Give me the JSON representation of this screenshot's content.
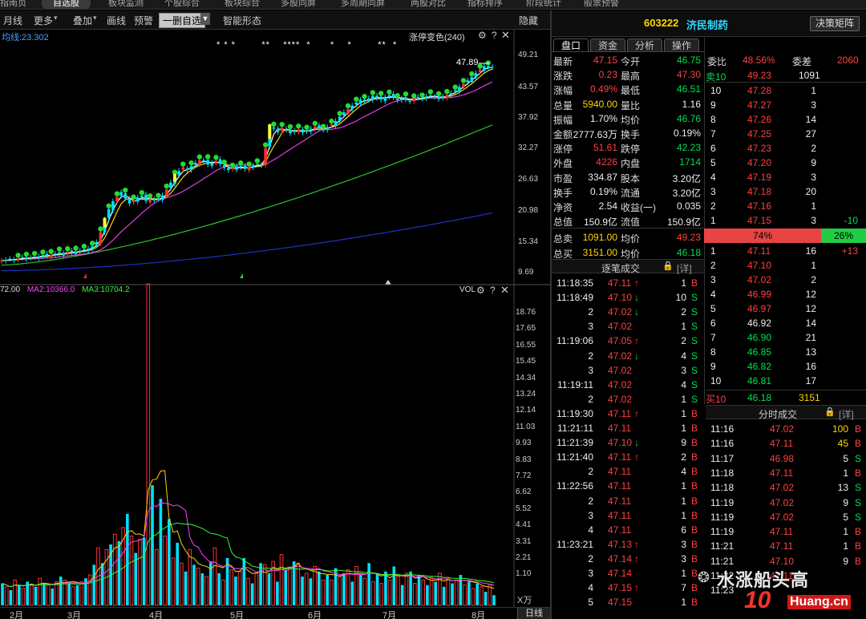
{
  "top_tabs": [
    {
      "label": "指南页",
      "active": false
    },
    {
      "label": "自选股",
      "active": true
    },
    {
      "label": "板块监测",
      "active": false
    },
    {
      "label": "个股综合",
      "active": false
    },
    {
      "label": "板块综合",
      "active": false
    },
    {
      "label": "多股同屏",
      "active": false
    },
    {
      "label": "多周期同屏",
      "active": false
    },
    {
      "label": "两股对比",
      "active": false
    },
    {
      "label": "指标排序",
      "active": false
    },
    {
      "label": "阶段统计",
      "active": false
    },
    {
      "label": "般票预警",
      "active": false
    }
  ],
  "toolbar": {
    "period": "月线",
    "more": "更多",
    "overlay": "叠加",
    "draw": "画线",
    "warn": "预警",
    "delete_watch": "一删自选",
    "smart_shape": "智能形态",
    "hide": "隐藏"
  },
  "kline": {
    "ma_label": "均线:23.302",
    "indicator": "涨停变色(240)",
    "price_tag": "47.89",
    "y_ticks": [
      "49.21",
      "43.57",
      "37.92",
      "32.27",
      "26.63",
      "20.98",
      "15.34",
      "9.69"
    ],
    "markers": "* * *        **    ****  *      *    *        **  *"
  },
  "volume": {
    "ma_labels": [
      "72.00",
      "MA2:10366.0",
      "MA3:10704.2"
    ],
    "title": "VOL",
    "y_ticks": [
      "18.76",
      "17.65",
      "16.55",
      "15.45",
      "14.34",
      "13.24",
      "12.14",
      "11.03",
      "9.93",
      "8.83",
      "7.72",
      "6.62",
      "5.52",
      "4.41",
      "3.31",
      "2.21",
      "1.10"
    ],
    "unit": "X万"
  },
  "x_axis": {
    "months": [
      "2月",
      "3月",
      "4月",
      "5月",
      "6月",
      "7月",
      "8月"
    ],
    "period_btn": "日线"
  },
  "stock": {
    "code": "603222",
    "name": "济民制药",
    "decision_btn": "决策矩阵"
  },
  "panel_tabs": [
    "盘口",
    "资金",
    "分析",
    "操作"
  ],
  "quote": [
    {
      "l1": "最新",
      "v1": "47.15",
      "c1": "red",
      "l2": "今开",
      "v2": "46.75",
      "c2": "green"
    },
    {
      "l1": "涨跌",
      "v1": "0.23",
      "c1": "red",
      "l2": "最高",
      "v2": "47.30",
      "c2": "red"
    },
    {
      "l1": "涨幅",
      "v1": "0.49%",
      "c1": "red",
      "l2": "最低",
      "v2": "46.51",
      "c2": "green"
    },
    {
      "l1": "总量",
      "v1": "5940.00",
      "c1": "yellow",
      "l2": "量比",
      "v2": "1.16",
      "c2": "white"
    },
    {
      "l1": "振幅",
      "v1": "1.70%",
      "c1": "white",
      "l2": "均价",
      "v2": "46.76",
      "c2": "green"
    },
    {
      "l1": "金额",
      "v1": "2777.63万",
      "c1": "white",
      "l2": "换手",
      "v2": "0.19%",
      "c2": "white"
    },
    {
      "l1": "涨停",
      "v1": "51.61",
      "c1": "red",
      "l2": "跌停",
      "v2": "42.23",
      "c2": "green"
    },
    {
      "l1": "外盘",
      "v1": "4226",
      "c1": "red",
      "l2": "内盘",
      "v2": "1714",
      "c2": "green"
    },
    {
      "l1": "市盈",
      "v1": "334.87",
      "c1": "white",
      "l2": "股本",
      "v2": "3.20亿",
      "c2": "white"
    },
    {
      "l1": "换手",
      "v1": "0.19%",
      "c1": "white",
      "l2": "流通",
      "v2": "3.20亿",
      "c2": "white"
    },
    {
      "l1": "净资",
      "v1": "2.54",
      "c1": "white",
      "l2": "收益(一)",
      "v2": "0.035",
      "c2": "white"
    },
    {
      "l1": "总值",
      "v1": "150.9亿",
      "c1": "white",
      "l2": "流值",
      "v2": "150.9亿",
      "c2": "white"
    },
    {
      "l1": "总卖",
      "v1": "1091.00",
      "c1": "yellow",
      "l2": "均价",
      "v2": "49.23",
      "c2": "red"
    },
    {
      "l1": "总买",
      "v1": "3151.00",
      "c1": "yellow",
      "l2": "均价",
      "v2": "46.18",
      "c2": "green"
    }
  ],
  "order_book": {
    "ratio_label": "委比",
    "ratio_value": "48.56%",
    "diff_label": "委差",
    "diff_value": "2060",
    "sell10": {
      "label": "卖10",
      "price": "49.23",
      "vol": "1091"
    },
    "sells": [
      {
        "lvl": "10",
        "price": "47.28",
        "vol": "1",
        "chg": ""
      },
      {
        "lvl": "9",
        "price": "47.27",
        "vol": "3",
        "chg": ""
      },
      {
        "lvl": "8",
        "price": "47.26",
        "vol": "14",
        "chg": ""
      },
      {
        "lvl": "7",
        "price": "47.25",
        "vol": "27",
        "chg": ""
      },
      {
        "lvl": "6",
        "price": "47.23",
        "vol": "2",
        "chg": ""
      },
      {
        "lvl": "5",
        "price": "47.20",
        "vol": "9",
        "chg": ""
      },
      {
        "lvl": "4",
        "price": "47.19",
        "vol": "3",
        "chg": ""
      },
      {
        "lvl": "3",
        "price": "47.18",
        "vol": "20",
        "chg": ""
      },
      {
        "lvl": "2",
        "price": "47.16",
        "vol": "1",
        "chg": ""
      },
      {
        "lvl": "1",
        "price": "47.15",
        "vol": "3",
        "chg": "-10"
      }
    ],
    "sell_pct": "74%",
    "buy_pct": "26%",
    "sell_frac": 0.74,
    "buys": [
      {
        "lvl": "1",
        "price": "47.11",
        "pc": "red",
        "vol": "16",
        "chg": "+13"
      },
      {
        "lvl": "2",
        "price": "47.10",
        "pc": "red",
        "vol": "1",
        "chg": ""
      },
      {
        "lvl": "3",
        "price": "47.02",
        "pc": "red",
        "vol": "2",
        "chg": ""
      },
      {
        "lvl": "4",
        "price": "46.99",
        "pc": "red",
        "vol": "12",
        "chg": ""
      },
      {
        "lvl": "5",
        "price": "46.97",
        "pc": "red",
        "vol": "12",
        "chg": ""
      },
      {
        "lvl": "6",
        "price": "46.92",
        "pc": "white",
        "vol": "14",
        "chg": ""
      },
      {
        "lvl": "7",
        "price": "46.90",
        "pc": "green",
        "vol": "21",
        "chg": ""
      },
      {
        "lvl": "8",
        "price": "46.85",
        "pc": "green",
        "vol": "13",
        "chg": ""
      },
      {
        "lvl": "9",
        "price": "46.82",
        "pc": "green",
        "vol": "16",
        "chg": ""
      },
      {
        "lvl": "10",
        "price": "46.81",
        "pc": "green",
        "vol": "17",
        "chg": ""
      }
    ],
    "buy10": {
      "label": "买10",
      "price": "46.18",
      "vol": "3151"
    }
  },
  "tick_trades": {
    "title": "逐笔成交",
    "detail": "[详]",
    "rows": [
      {
        "t": "11:18:35",
        "p": "47.11",
        "a": "up",
        "v": "1",
        "bs": "B"
      },
      {
        "t": "11:18:49",
        "p": "47.10",
        "a": "down",
        "v": "10",
        "bs": "S"
      },
      {
        "t": "2",
        "p": "47.02",
        "a": "down",
        "v": "2",
        "bs": "S"
      },
      {
        "t": "3",
        "p": "47.02",
        "a": "",
        "v": "1",
        "bs": "S"
      },
      {
        "t": "11:19:06",
        "p": "47.05",
        "a": "up",
        "v": "2",
        "bs": "S"
      },
      {
        "t": "2",
        "p": "47.02",
        "a": "down",
        "v": "4",
        "bs": "S"
      },
      {
        "t": "3",
        "p": "47.02",
        "a": "",
        "v": "3",
        "bs": "S"
      },
      {
        "t": "11:19:11",
        "p": "47.02",
        "a": "",
        "v": "4",
        "bs": "S"
      },
      {
        "t": "2",
        "p": "47.02",
        "a": "",
        "v": "1",
        "bs": "S"
      },
      {
        "t": "11:19:30",
        "p": "47.11",
        "a": "up",
        "v": "1",
        "bs": "B"
      },
      {
        "t": "11:21:11",
        "p": "47.11",
        "a": "",
        "v": "1",
        "bs": "B"
      },
      {
        "t": "11:21:39",
        "p": "47.10",
        "a": "down",
        "v": "9",
        "bs": "B"
      },
      {
        "t": "11:21:40",
        "p": "47.11",
        "a": "up",
        "v": "2",
        "bs": "B"
      },
      {
        "t": "2",
        "p": "47.11",
        "a": "",
        "v": "4",
        "bs": "B"
      },
      {
        "t": "11:22:56",
        "p": "47.11",
        "a": "",
        "v": "1",
        "bs": "B"
      },
      {
        "t": "2",
        "p": "47.11",
        "a": "",
        "v": "1",
        "bs": "B"
      },
      {
        "t": "3",
        "p": "47.11",
        "a": "",
        "v": "1",
        "bs": "B"
      },
      {
        "t": "4",
        "p": "47.11",
        "a": "",
        "v": "6",
        "bs": "B"
      },
      {
        "t": "11:23:21",
        "p": "47.13",
        "a": "up",
        "v": "3",
        "bs": "B"
      },
      {
        "t": "2",
        "p": "47.14",
        "a": "up",
        "v": "3",
        "bs": "B"
      },
      {
        "t": "3",
        "p": "47.14",
        "a": "",
        "v": "1",
        "bs": "B"
      },
      {
        "t": "4",
        "p": "47.15",
        "a": "up",
        "v": "7",
        "bs": "B"
      },
      {
        "t": "5",
        "p": "47.15",
        "a": "",
        "v": "1",
        "bs": "B"
      }
    ]
  },
  "minute_trades": {
    "title": "分时成交",
    "detail": "[详]",
    "rows": [
      {
        "t": "11:16",
        "p": "47.02",
        "pc": "red",
        "v": "100",
        "bs": "B"
      },
      {
        "t": "11:16",
        "p": "47.11",
        "pc": "red",
        "v": "45",
        "bs": "B"
      },
      {
        "t": "11:17",
        "p": "46.98",
        "pc": "red",
        "v": "5",
        "bs": "S"
      },
      {
        "t": "11:18",
        "p": "47.11",
        "pc": "red",
        "v": "1",
        "bs": "B"
      },
      {
        "t": "11:18",
        "p": "47.02",
        "pc": "red",
        "v": "13",
        "bs": "S"
      },
      {
        "t": "11:19",
        "p": "47.02",
        "pc": "red",
        "v": "9",
        "bs": "S"
      },
      {
        "t": "11:19",
        "p": "47.02",
        "pc": "red",
        "v": "5",
        "bs": "S"
      },
      {
        "t": "11:19",
        "p": "47.11",
        "pc": "red",
        "v": "1",
        "bs": "B"
      },
      {
        "t": "11:21",
        "p": "47.11",
        "pc": "red",
        "v": "1",
        "bs": "B"
      },
      {
        "t": "11:21",
        "p": "47.10",
        "pc": "red",
        "v": "9",
        "bs": "B"
      },
      {
        "t": "11:22",
        "p": "47.11",
        "pc": "red",
        "v": "",
        "bs": ""
      },
      {
        "t": "11:23",
        "p": "",
        "pc": "red",
        "v": "",
        "bs": ""
      }
    ]
  },
  "watermark": {
    "text": "水涨船头高",
    "brand": "Huang.cn",
    "badge": "10"
  },
  "chart_data": [
    {
      "type": "candlestick",
      "price_axis": [
        9.69,
        49.21
      ],
      "close": [
        12.0,
        12.1,
        12.3,
        12.2,
        12.4,
        12.5,
        12.6,
        12.5,
        12.7,
        12.8,
        13.0,
        12.9,
        13.1,
        13.3,
        13.2,
        13.4,
        13.6,
        13.5,
        13.7,
        13.8,
        14.0,
        14.2,
        14.6,
        15.4,
        17.2,
        19.5,
        21.4,
        22.8,
        23.6,
        24.5,
        23.3,
        22.4,
        23.0,
        23.5,
        23.8,
        22.9,
        23.2,
        23.0,
        23.3,
        23.9,
        25.0,
        26.2,
        27.5,
        28.3,
        29.0,
        28.5,
        29.2,
        29.8,
        30.3,
        30.1,
        29.5,
        29.8,
        30.2,
        29.6,
        28.9,
        28.5,
        28.8,
        29.2,
        29.0,
        28.7,
        29.0,
        29.3,
        29.6,
        29.4,
        32.5,
        36.5,
        36.0,
        35.4,
        36.2,
        35.8,
        35.2,
        35.6,
        35.9,
        35.3,
        35.7,
        36.0,
        36.4,
        36.1,
        35.8,
        36.3,
        36.8,
        37.4,
        38.2,
        39.0,
        39.6,
        40.2,
        40.8,
        41.3,
        41.0,
        41.5,
        42.0,
        41.6,
        41.3,
        41.8,
        42.1,
        41.7,
        41.2,
        41.5,
        41.3,
        41.0,
        41.4,
        41.8,
        41.5,
        41.9,
        42.1,
        41.8,
        41.4,
        41.9,
        42.2,
        42.5,
        43.0,
        43.6,
        44.2,
        44.8,
        45.4,
        46.1,
        46.8,
        47.4,
        47.0,
        47.15
      ],
      "ma_lines": [
        {
          "color": "#ffffff",
          "values_desc": "MA5"
        },
        {
          "color": "#ffd700",
          "values_desc": "MA10"
        },
        {
          "color": "#e040e0",
          "values_desc": "MA30"
        },
        {
          "color": "#30c030",
          "values_desc": "MA60"
        },
        {
          "color": "#2030c0",
          "values_desc": "MA120"
        }
      ]
    },
    {
      "type": "bar",
      "title": "VOL",
      "ylim": [
        0,
        19.0
      ],
      "values": [
        1.3,
        1.1,
        0.9,
        1.5,
        1.2,
        1.0,
        1.4,
        1.2,
        1.1,
        1.6,
        1.3,
        1.2,
        1.0,
        1.4,
        1.7,
        1.5,
        1.3,
        1.1,
        1.2,
        1.4,
        1.6,
        1.8,
        2.4,
        3.4,
        2.5,
        3.3,
        3.6,
        4.2,
        3.8,
        4.6,
        5.4,
        4.1,
        3.1,
        3.9,
        4.0,
        19.0,
        7.1,
        3.3,
        6.3,
        4.1,
        5.1,
        2.8,
        3.7,
        2.5,
        2.0,
        3.3,
        2.4,
        2.2,
        1.9,
        1.7,
        2.6,
        3.4,
        1.9,
        1.5,
        2.8,
        2.1,
        1.7,
        2.0,
        2.8,
        1.6,
        1.3,
        1.9,
        2.5,
        2.4,
        1.9,
        2.6,
        1.4,
        3.0,
        2.1,
        2.2,
        2.6,
        2.5,
        1.7,
        1.9,
        1.6,
        2.3,
        2.0,
        1.5,
        1.8,
        1.5,
        2.2,
        1.7,
        1.9,
        2.1,
        1.4,
        2.3,
        1.8,
        1.6,
        2.5,
        1.4,
        1.9,
        1.3,
        2.0,
        1.5,
        2.3,
        1.7,
        1.2,
        1.9,
        2.0,
        1.3,
        1.8,
        1.5,
        1.2,
        1.6,
        1.4,
        1.9,
        1.1,
        1.6,
        1.3,
        1.5,
        1.8,
        1.2,
        1.4,
        1.0,
        1.3,
        1.1,
        0.8,
        1.2,
        0.6
      ],
      "up_down": "alternating red/cyan"
    }
  ]
}
